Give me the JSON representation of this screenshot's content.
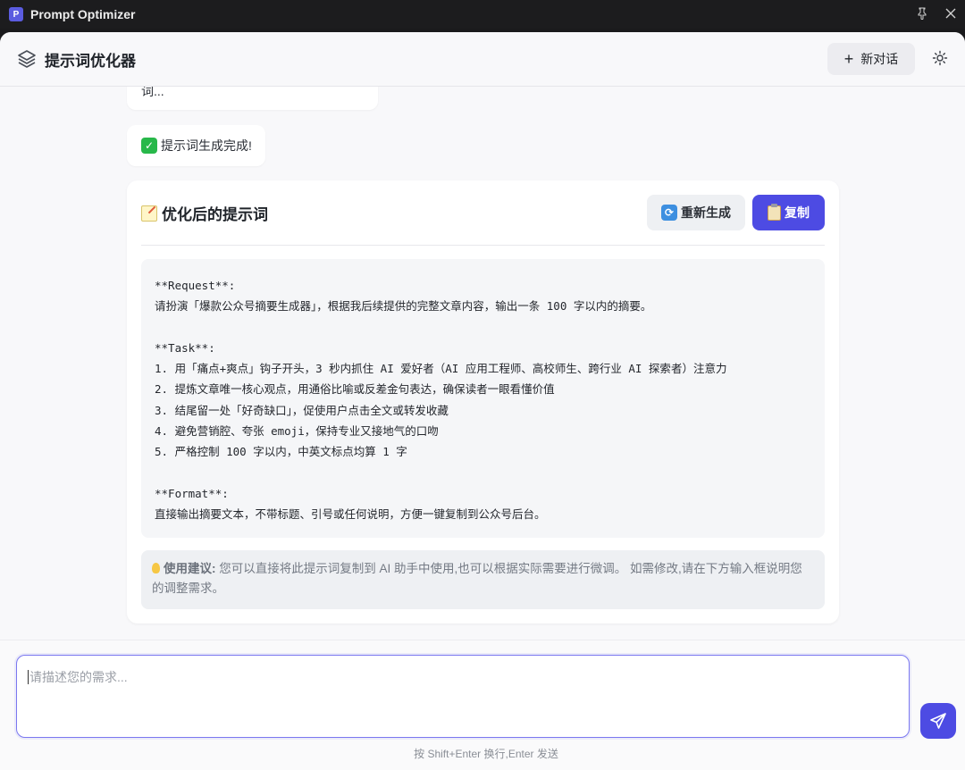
{
  "titlebar": {
    "app_icon_letter": "P",
    "title": "Prompt Optimizer"
  },
  "header": {
    "app_name": "提示词优化器",
    "new_chat_label": "新对话"
  },
  "messages": {
    "collecting": "已收集足够信息，现在为您生成提示词...",
    "done": "提示词生成完成!"
  },
  "result": {
    "title": "优化后的提示词",
    "regenerate_label": "重新生成",
    "copy_label": "复制",
    "prompt_lines": [
      "**Request**:",
      "请扮演「爆款公众号摘要生成器」，根据我后续提供的完整文章内容，输出一条 100 字以内的摘要。",
      "",
      "**Task**:",
      "1. 用「痛点+爽点」钩子开头，3 秒内抓住 AI 爱好者（AI 应用工程师、高校师生、跨行业 AI 探索者）注意力",
      "2. 提炼文章唯一核心观点，用通俗比喻或反差金句表达，确保读者一眼看懂价值",
      "3. 结尾留一处「好奇缺口」，促使用户点击全文或转发收藏",
      "4. 避免营销腔、夸张 emoji，保持专业又接地气的口吻",
      "5. 严格控制 100 字以内，中英文标点均算 1 字",
      "",
      "**Format**:",
      "直接输出摘要文本，不带标题、引号或任何说明，方便一键复制到公众号后台。"
    ],
    "tip_label": "使用建议:",
    "tip_text": " 您可以直接将此提示词复制到 AI 助手中使用,也可以根据实际需要进行微调。 如需修改,请在下方输入框说明您的调整需求。"
  },
  "composer": {
    "placeholder": "请描述您的需求...",
    "hint": "按 Shift+Enter 换行,Enter 发送"
  },
  "colors": {
    "accent": "#4d4be3",
    "titlebar_bg": "#1c1c1e",
    "window_bg": "#f8f8fa"
  }
}
